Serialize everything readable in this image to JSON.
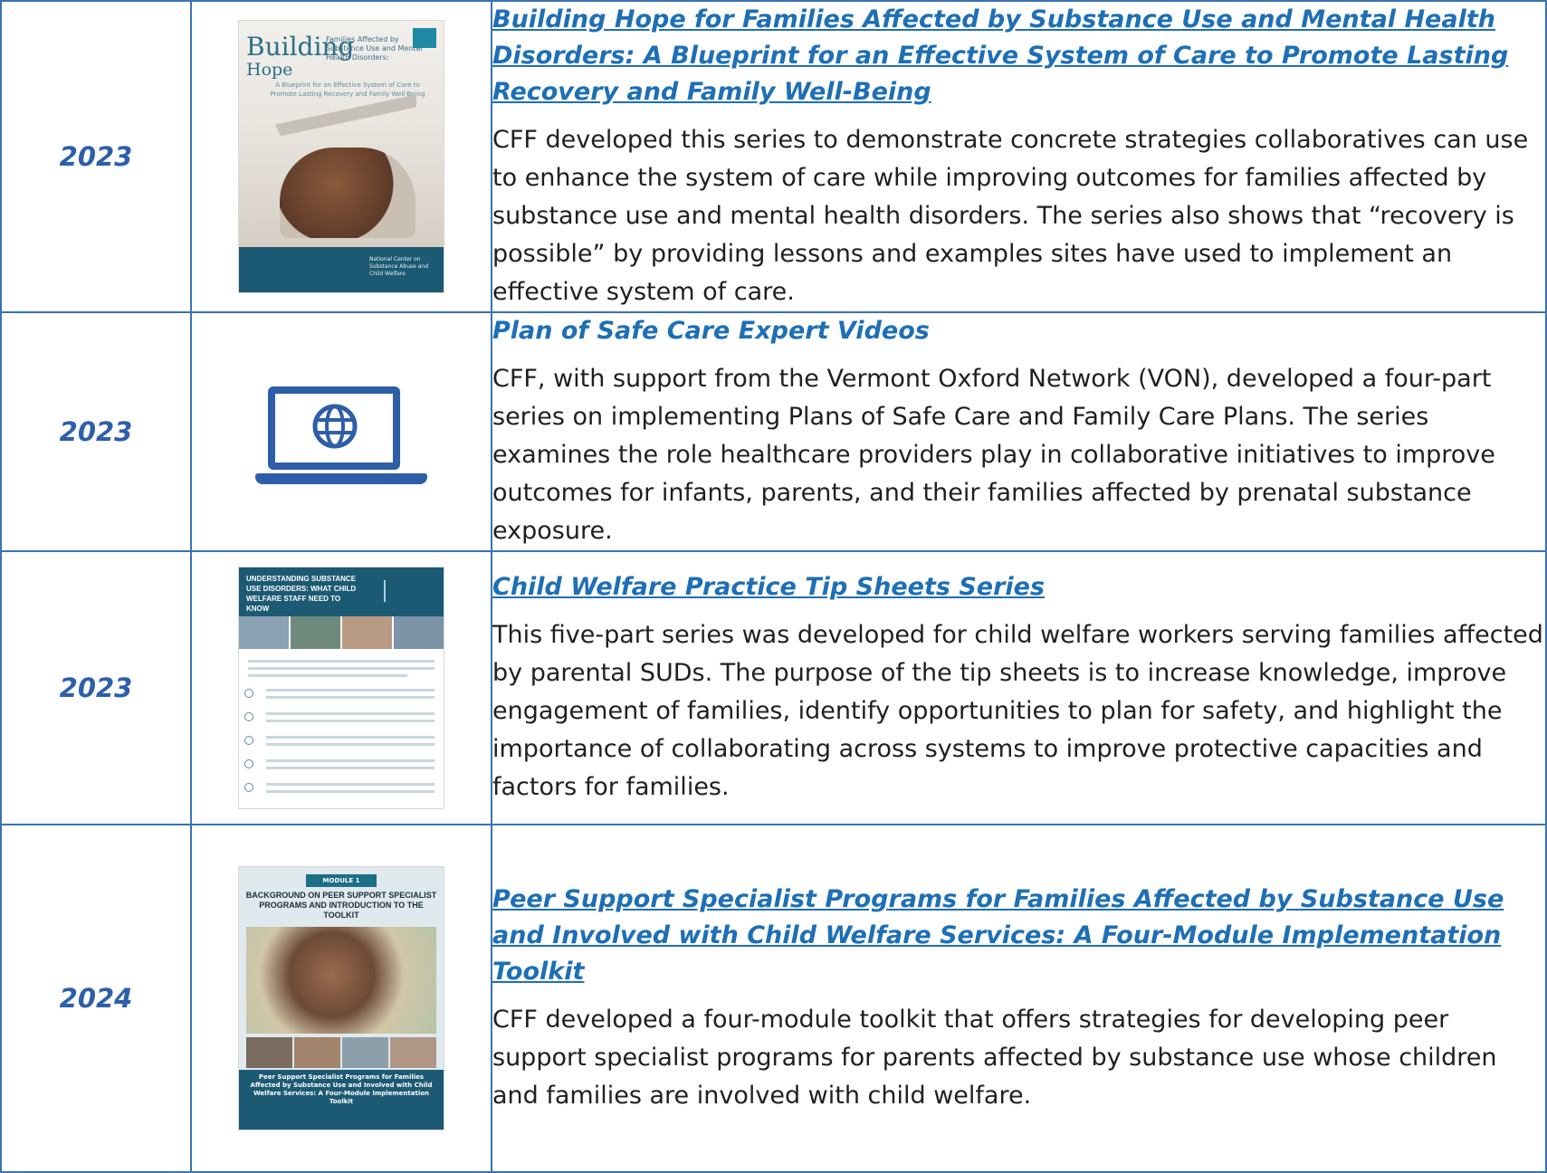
{
  "rows": [
    {
      "year": "2023",
      "title": "Building Hope for Families Affected by Substance Use and Mental Health Disorders: A Blueprint for an Effective System of Care to Promote Lasting Recovery and Family Well-Being",
      "description": "CFF developed this series to demonstrate concrete strategies collaboratives can use to enhance the system of care while improving outcomes for families affected by substance use and mental health disorders. The series also shows that “recovery is possible” by providing lessons and examples sites have used to implement an effective system of care.",
      "cover": {
        "logo_word1": "Building",
        "logo_word2": "Hope",
        "subtitle": "Families Affected by Substance Use and Mental Health Disorders:",
        "blurb": "A Blueprint for an Effective System of Care to Promote Lasting Recovery and Family Well-Being",
        "publisher": "National Center on Substance Abuse and Child Welfare"
      }
    },
    {
      "year": "2023",
      "title": "Plan of Safe Care Expert Videos",
      "description": "CFF, with support from the Vermont Oxford Network (VON), developed a four-part series on implementing Plans of Safe Care and Family Care Plans. The series examines the role healthcare providers play in collaborative initiatives to improve outcomes for infants, parents, and their families affected by prenatal substance exposure.",
      "icon": "laptop-globe-icon"
    },
    {
      "year": "2023",
      "title": "Child Welfare Practice Tip Sheets Series",
      "description": "This five-part series was developed for child welfare workers serving families affected by parental SUDs. The purpose of the tip sheets is to increase knowledge, improve engagement of families, identify opportunities to plan for safety, and highlight the importance of collaborating across systems to improve protective capacities and factors for families.",
      "cover": {
        "heading": "UNDERSTANDING SUBSTANCE USE DISORDERS: WHAT CHILD WELFARE STAFF NEED TO KNOW"
      }
    },
    {
      "year": "2024",
      "title": "Peer Support Specialist Programs for Families Affected by Substance Use and Involved with Child Welfare Services: A Four-Module Implementation Toolkit",
      "description": "CFF developed a four-module toolkit that offers strategies for developing peer support specialist programs for parents affected by substance use whose children and families are involved with child welfare.",
      "cover": {
        "module": "MODULE 1",
        "heading": "BACKGROUND ON PEER SUPPORT SPECIALIST PROGRAMS AND INTRODUCTION TO THE TOOLKIT",
        "band": "Peer Support Specialist Programs for Families Affected by Substance Use and Involved with Child Welfare Services: A Four-Module Implementation Toolkit"
      }
    }
  ],
  "colors": {
    "border": "#3a73b0",
    "year": "#2d5faa",
    "link": "#1e6fb5",
    "text": "#1f1f1f",
    "icon": "#2f5ea8",
    "cover_dark": "#1c5a73"
  }
}
